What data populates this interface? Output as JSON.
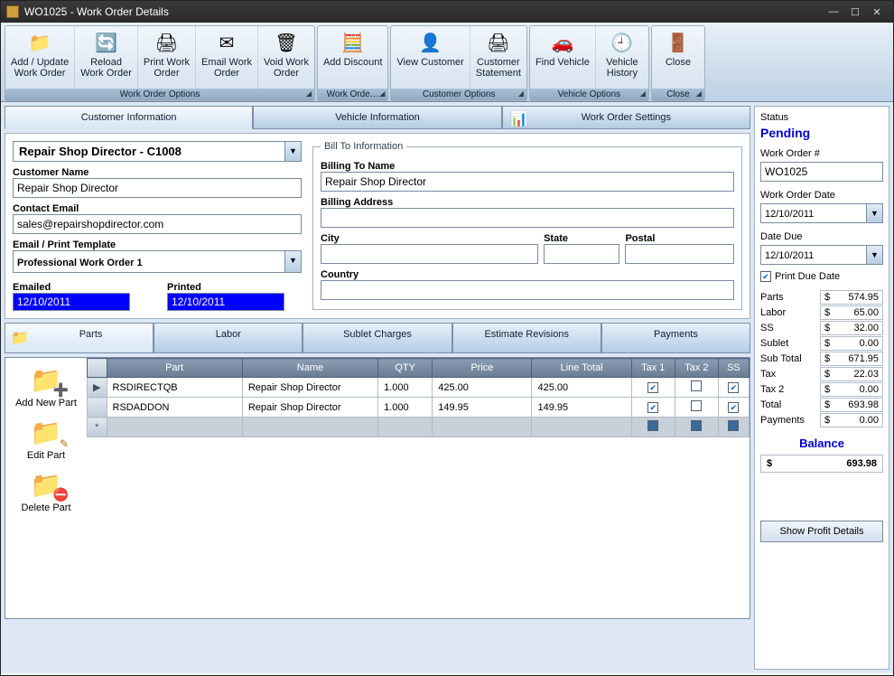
{
  "window": {
    "title": "WO1025 - Work Order Details"
  },
  "ribbon": {
    "groups": [
      {
        "label": "Work Order Options",
        "buttons": [
          {
            "label": "Add / Update\nWork Order",
            "icon": "📁"
          },
          {
            "label": "Reload\nWork Order",
            "icon": "🔄"
          },
          {
            "label": "Print Work\nOrder",
            "icon": "🖨"
          },
          {
            "label": "Email Work\nOrder",
            "icon": "✉"
          },
          {
            "label": "Void Work\nOrder",
            "icon": "🗑"
          }
        ]
      },
      {
        "label": "Work Orde…",
        "buttons": [
          {
            "label": "Add Discount",
            "icon": "🧮"
          }
        ]
      },
      {
        "label": "Customer Options",
        "buttons": [
          {
            "label": "View Customer",
            "icon": "👤"
          },
          {
            "label": "Customer\nStatement",
            "icon": "🖨"
          }
        ]
      },
      {
        "label": "Vehicle Options",
        "buttons": [
          {
            "label": "Find Vehicle",
            "icon": "🚗"
          },
          {
            "label": "Vehicle\nHistory",
            "icon": "🕘"
          }
        ]
      },
      {
        "label": "Close",
        "buttons": [
          {
            "label": "Close",
            "icon": "🚪"
          }
        ]
      }
    ]
  },
  "topTabs": [
    "Customer Information",
    "Vehicle Information",
    "Work Order Settings"
  ],
  "customer": {
    "heading": "Repair Shop Director - C1008",
    "nameLabel": "Customer Name",
    "name": "Repair Shop Director",
    "emailLabel": "Contact Email",
    "email": "sales@repairshopdirector.com",
    "templateLabel": "Email / Print Template",
    "template": "Professional Work Order 1",
    "emailedLabel": "Emailed",
    "emailed": "12/10/2011",
    "printedLabel": "Printed",
    "printed": "12/10/2011"
  },
  "billTo": {
    "legend": "Bill To Information",
    "nameLabel": "Billing To Name",
    "name": "Repair Shop Director",
    "addressLabel": "Billing Address",
    "address": "",
    "cityLabel": "City",
    "city": "",
    "stateLabel": "State",
    "state": "",
    "postalLabel": "Postal",
    "postal": "",
    "countryLabel": "Country",
    "country": ""
  },
  "bottomTabs": [
    "Parts",
    "Labor",
    "Sublet Charges",
    "Estimate Revisions",
    "Payments"
  ],
  "sideButtons": {
    "add": "Add New Part",
    "edit": "Edit Part",
    "delete": "Delete Part"
  },
  "gridHeaders": [
    "Part",
    "Name",
    "QTY",
    "Price",
    "Line Total",
    "Tax 1",
    "Tax 2",
    "SS"
  ],
  "gridRows": [
    {
      "part": "RSDIRECTQB",
      "name": "Repair Shop Director",
      "qty": "1.000",
      "price": "425.00",
      "lineTotal": "425.00",
      "tax1": true,
      "tax2": false,
      "ss": true
    },
    {
      "part": "RSDADDON",
      "name": "Repair Shop Director",
      "qty": "1.000",
      "price": "149.95",
      "lineTotal": "149.95",
      "tax1": true,
      "tax2": false,
      "ss": true
    }
  ],
  "status": {
    "label": "Status",
    "value": "Pending",
    "woNumLabel": "Work Order #",
    "woNum": "WO1025",
    "woDateLabel": "Work Order Date",
    "woDate": "12/10/2011",
    "dueLabel": "Date Due",
    "due": "12/10/2011",
    "printDueLabel": "Print Due Date",
    "printDue": true
  },
  "totals": {
    "rows": [
      {
        "label": "Parts",
        "amt": "574.95"
      },
      {
        "label": "Labor",
        "amt": "65.00"
      },
      {
        "label": "SS",
        "amt": "32.00"
      },
      {
        "label": "Sublet",
        "amt": "0.00"
      },
      {
        "label": "Sub Total",
        "amt": "671.95"
      },
      {
        "label": "Tax",
        "amt": "22.03"
      },
      {
        "label": "Tax 2",
        "amt": "0.00"
      },
      {
        "label": "Total",
        "amt": "693.98"
      },
      {
        "label": "Payments",
        "amt": "0.00"
      }
    ],
    "balanceLabel": "Balance",
    "balanceAmt": "693.98"
  },
  "showProfit": "Show Profit Details"
}
